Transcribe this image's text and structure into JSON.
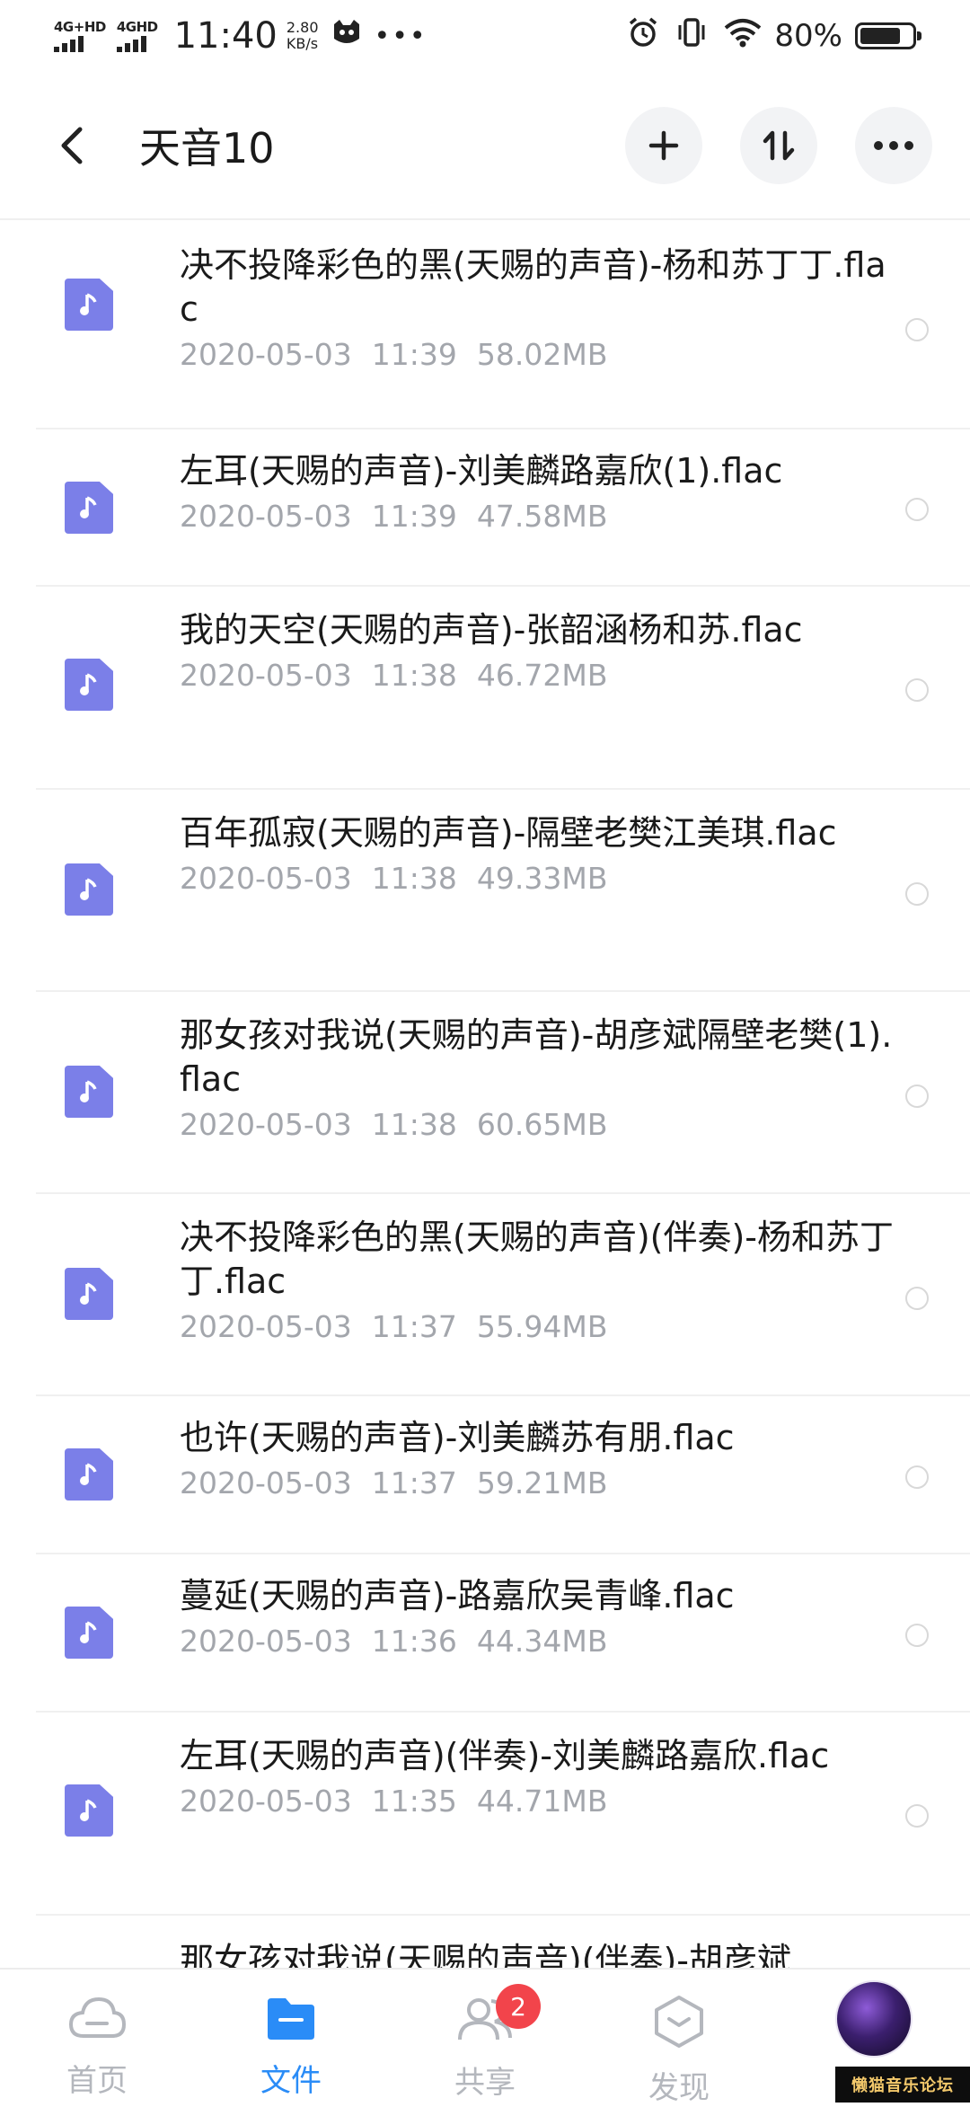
{
  "status_bar": {
    "net1": "4G+HD",
    "net2": "4GHD",
    "time": "11:40",
    "speed_value": "2.80",
    "speed_unit": "KB/s",
    "battery_pct": "80%",
    "battery_level": 0.8
  },
  "header": {
    "title": "天音10"
  },
  "files": [
    {
      "name": "决不投降彩色的黑(天赐的声音)-杨和苏丁丁.flac",
      "date": "2020-05-03",
      "time": "11:39",
      "size": "58.02MB"
    },
    {
      "name": "左耳(天赐的声音)-刘美麟路嘉欣(1).flac",
      "date": "2020-05-03",
      "time": "11:39",
      "size": "47.58MB"
    },
    {
      "name": "我的天空(天赐的声音)-张韶涵杨和苏.flac",
      "date": "2020-05-03",
      "time": "11:38",
      "size": "46.72MB"
    },
    {
      "name": "百年孤寂(天赐的声音)-隔壁老樊江美琪.flac",
      "date": "2020-05-03",
      "time": "11:38",
      "size": "49.33MB"
    },
    {
      "name": "那女孩对我说(天赐的声音)-胡彦斌隔壁老樊(1).flac",
      "date": "2020-05-03",
      "time": "11:38",
      "size": "60.65MB"
    },
    {
      "name": "决不投降彩色的黑(天赐的声音)(伴奏)-杨和苏丁丁.flac",
      "date": "2020-05-03",
      "time": "11:37",
      "size": "55.94MB"
    },
    {
      "name": "也许(天赐的声音)-刘美麟苏有朋.flac",
      "date": "2020-05-03",
      "time": "11:37",
      "size": "59.21MB"
    },
    {
      "name": "蔓延(天赐的声音)-路嘉欣吴青峰.flac",
      "date": "2020-05-03",
      "time": "11:36",
      "size": "44.34MB"
    },
    {
      "name": "左耳(天赐的声音)(伴奏)-刘美麟路嘉欣.flac",
      "date": "2020-05-03",
      "time": "11:35",
      "size": "44.71MB"
    },
    {
      "name": "那女孩对我说(天赐的声音)(伴奏)-胡彦斌",
      "date": "",
      "time": "",
      "size": ""
    }
  ],
  "bottom_nav": {
    "home": "首页",
    "files": "文件",
    "share": "共享",
    "share_badge": "2",
    "discover": "发现"
  },
  "watermark": "懒猫音乐论坛",
  "colors": {
    "accent": "#2a8cf7",
    "file_icon": "#7b7fe8",
    "badge": "#f2444b"
  }
}
